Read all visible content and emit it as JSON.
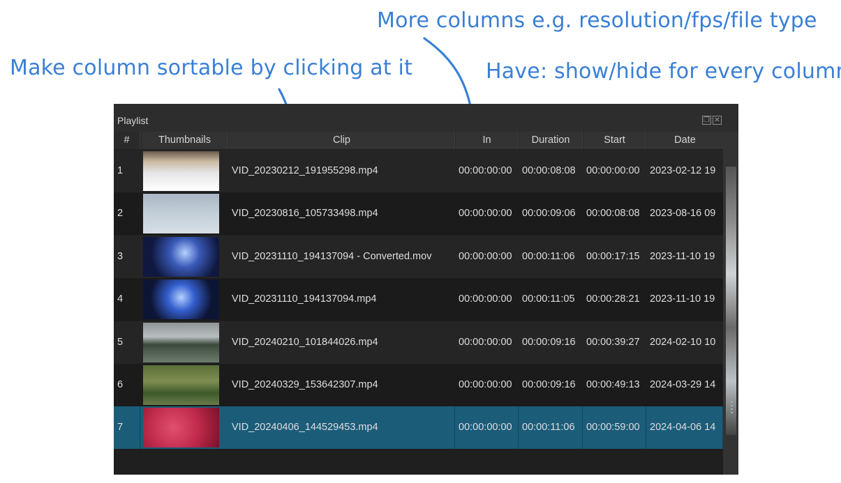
{
  "annotations": {
    "more_columns": "More columns e.g. resolution/fps/file type",
    "sortable": "Make column sortable by clicking at it",
    "show_hide": "Have: show/hide for every column"
  },
  "panel": {
    "title": "Playlist",
    "header_icons": [
      "restore-icon",
      "close-icon"
    ]
  },
  "columns": {
    "num": "#",
    "thumbnails": "Thumbnails",
    "clip": "Clip",
    "in": "In",
    "duration": "Duration",
    "start": "Start",
    "date": "Date"
  },
  "rows": [
    {
      "num": "1",
      "clip": "VID_20230212_191955298.mp4",
      "in": "00:00:00:00",
      "duration": "00:00:08:08",
      "start": "00:00:00:00",
      "date": "2023-02-12 19"
    },
    {
      "num": "2",
      "clip": "VID_20230816_105733498.mp4",
      "in": "00:00:00:00",
      "duration": "00:00:09:06",
      "start": "00:00:08:08",
      "date": "2023-08-16 09"
    },
    {
      "num": "3",
      "clip": "VID_20231110_194137094 - Converted.mov",
      "in": "00:00:00:00",
      "duration": "00:00:11:06",
      "start": "00:00:17:15",
      "date": "2023-11-10 19"
    },
    {
      "num": "4",
      "clip": "VID_20231110_194137094.mp4",
      "in": "00:00:00:00",
      "duration": "00:00:11:05",
      "start": "00:00:28:21",
      "date": "2023-11-10 19"
    },
    {
      "num": "5",
      "clip": "VID_20240210_101844026.mp4",
      "in": "00:00:00:00",
      "duration": "00:00:09:16",
      "start": "00:00:39:27",
      "date": "2024-02-10 10"
    },
    {
      "num": "6",
      "clip": "VID_20240329_153642307.mp4",
      "in": "00:00:00:00",
      "duration": "00:00:09:16",
      "start": "00:00:49:13",
      "date": "2024-03-29 14"
    },
    {
      "num": "7",
      "clip": "VID_20240406_144529453.mp4",
      "in": "00:00:00:00",
      "duration": "00:00:11:06",
      "start": "00:00:59:00",
      "date": "2024-04-06 14"
    }
  ],
  "selected_row": 7,
  "colors": {
    "accent_note": "#3a7fd5",
    "selected_row": "#1b5c79"
  }
}
